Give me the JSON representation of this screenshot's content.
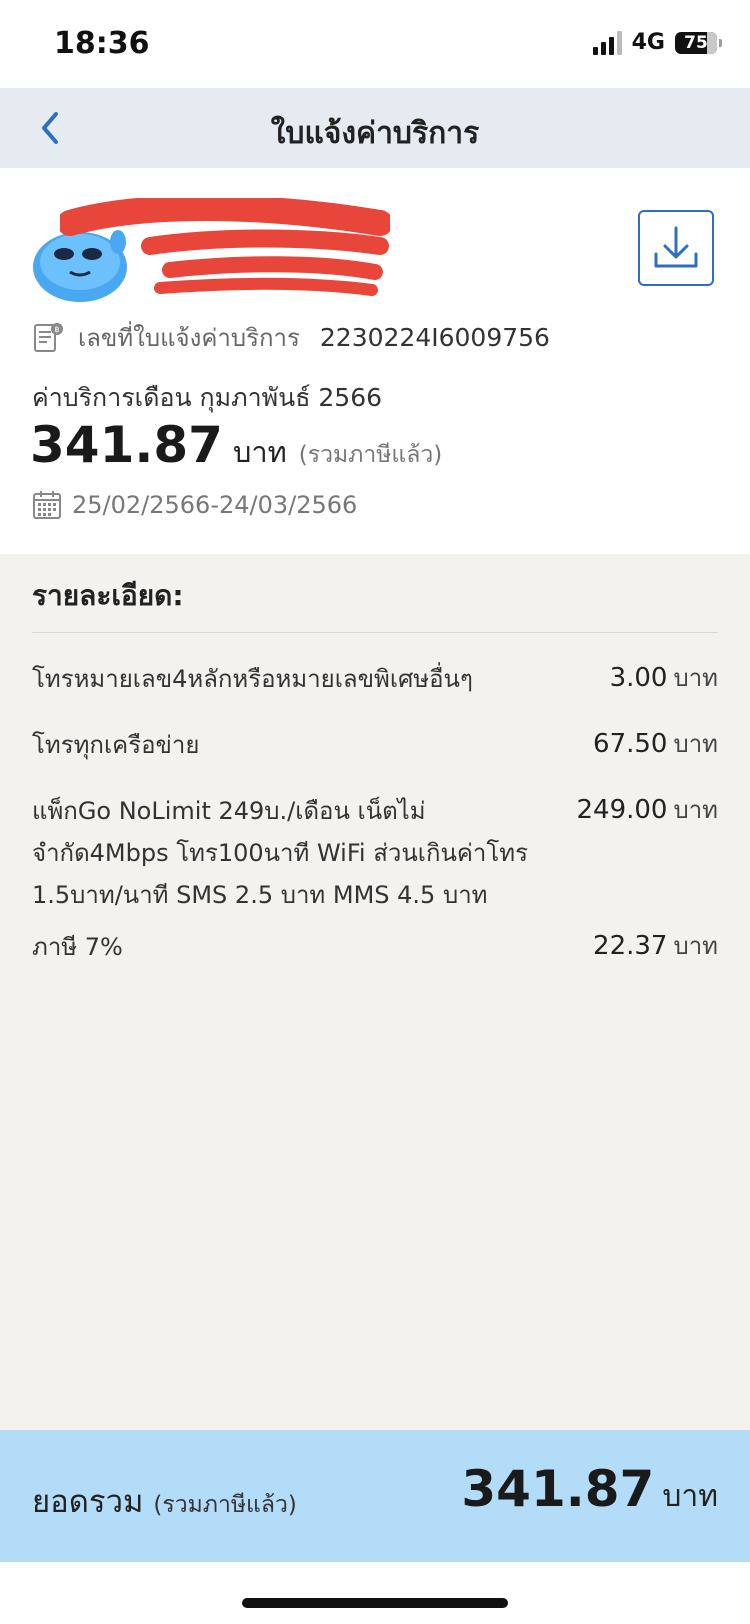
{
  "status_bar": {
    "time": "18:36",
    "network": "4G",
    "battery": "75"
  },
  "header": {
    "title": "ใบแจ้งค่าบริการ",
    "back_icon": "chevron-left-icon"
  },
  "summary": {
    "download_icon": "download-icon",
    "invoice_label": "เลขที่ใบแจ้งค่าบริการ",
    "invoice_number": "2230224I6009756",
    "billing_month": "ค่าบริการเดือน กุมภาพันธ์ 2566",
    "amount": "341.87",
    "currency": "บาท",
    "tax_note": "(รวมภาษีแล้ว)",
    "period": "25/02/2566-24/03/2566"
  },
  "details": {
    "title": "รายละเอียด:",
    "items": [
      {
        "desc": "โทรหมายเลข4หลักหรือหมายเลขพิเศษอื่นๆ",
        "amount": "3.00",
        "unit": "บาท"
      },
      {
        "desc": "โทรทุกเครือข่าย",
        "amount": "67.50",
        "unit": "บาท"
      },
      {
        "desc": "แพ็กGo NoLimit 249บ./เดือน เน็ตไม่จำกัด4Mbps โทร100นาที WiFi ส่วนเกินค่าโทร 1.5บาท/นาที SMS 2.5 บาท MMS 4.5 บาท",
        "amount": "249.00",
        "unit": "บาท"
      },
      {
        "desc": "ภาษี 7%",
        "amount": "22.37",
        "unit": "บาท"
      }
    ]
  },
  "total": {
    "label": "ยอดรวม",
    "note": "(รวมภาษีแล้ว)",
    "amount": "341.87",
    "unit": "บาท"
  },
  "colors": {
    "header_bg": "#e6ebf2",
    "accent_blue": "#2d6fc1",
    "details_bg": "#f3f2ee",
    "total_bg": "#b3dcf9",
    "redaction": "#e8463a"
  }
}
